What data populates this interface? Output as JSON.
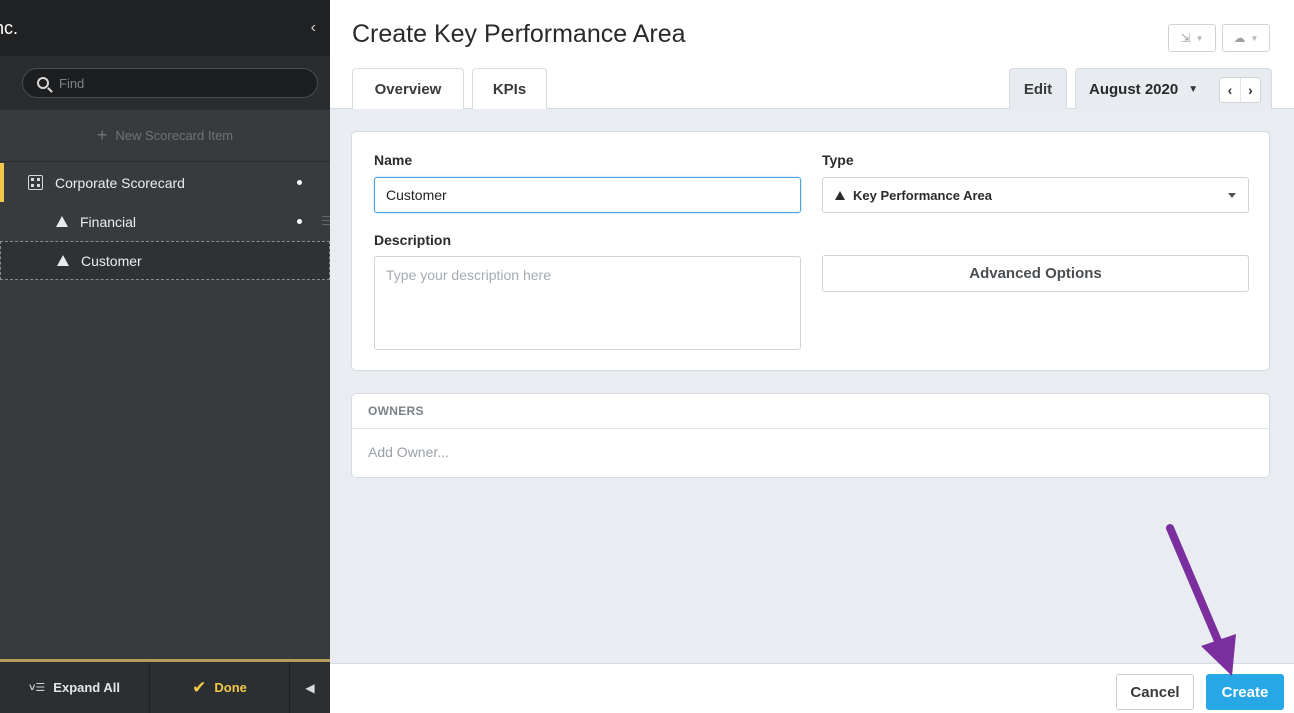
{
  "sidebar": {
    "org_name": "nc.",
    "collapse_icon": "chevron-left-icon",
    "search": {
      "placeholder": "Find",
      "value": ""
    },
    "new_item_label": "New Scorecard Item",
    "tree": [
      {
        "label": "Corporate Scorecard",
        "icon": "scorecard-grid-icon",
        "has_dot": true
      },
      {
        "label": "Financial",
        "icon": "triangle-icon",
        "has_dot": true
      },
      {
        "label": "Customer",
        "icon": "triangle-icon",
        "has_dot": false
      }
    ],
    "footer": {
      "expand_all": "Expand All",
      "done": "Done"
    }
  },
  "main": {
    "title": "Create Key Performance Area",
    "tabs": [
      {
        "label": "Overview"
      },
      {
        "label": "KPIs"
      }
    ],
    "edit_tab": "Edit",
    "period": "August 2020",
    "form": {
      "name_label": "Name",
      "name_value": "Customer",
      "type_label": "Type",
      "type_value": "Key Performance Area",
      "description_label": "Description",
      "description_placeholder": "Type your description here",
      "advanced_options": "Advanced Options"
    },
    "owners": {
      "header": "OWNERS",
      "add": "Add Owner..."
    },
    "actions": {
      "cancel": "Cancel",
      "create": "Create"
    }
  },
  "colors": {
    "sidebar_bg": "#383b3e",
    "accent_gold": "#f2c84b",
    "primary_blue": "#28a7e6",
    "annotation_arrow": "#7b2f9e"
  }
}
